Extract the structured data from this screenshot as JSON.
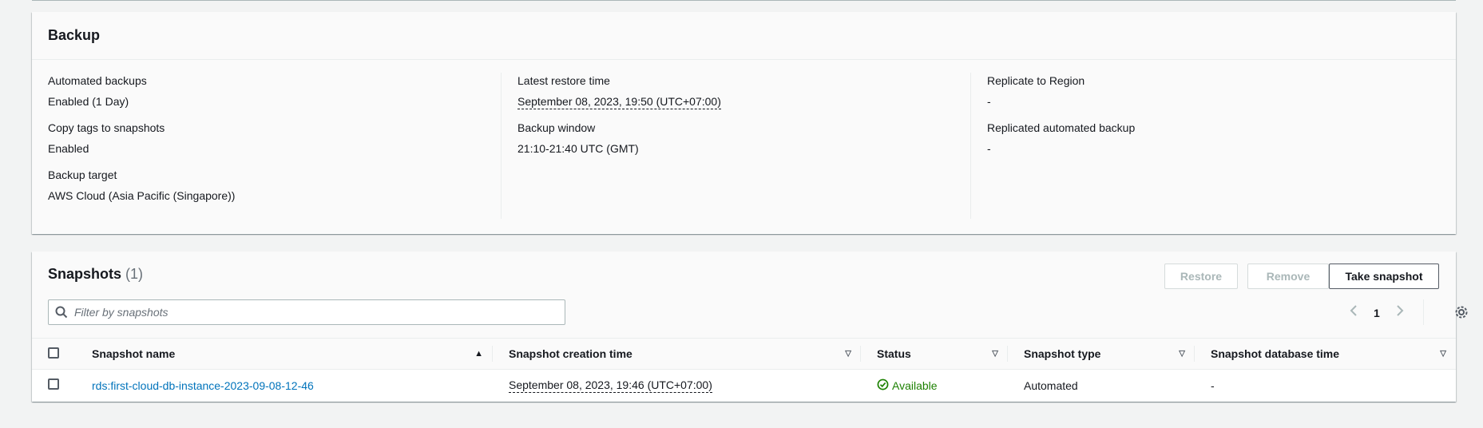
{
  "backup": {
    "title": "Backup",
    "col1": [
      {
        "label": "Automated backups",
        "value": "Enabled (1 Day)"
      },
      {
        "label": "Copy tags to snapshots",
        "value": "Enabled"
      },
      {
        "label": "Backup target",
        "value": "AWS Cloud (Asia Pacific (Singapore))"
      }
    ],
    "col2": [
      {
        "label": "Latest restore time",
        "value": "September 08, 2023, 19:50 (UTC+07:00)"
      },
      {
        "label": "Backup window",
        "value": "21:10-21:40 UTC (GMT)"
      }
    ],
    "col3": [
      {
        "label": "Replicate to Region",
        "value": "-"
      },
      {
        "label": "Replicated automated backup",
        "value": "-"
      }
    ]
  },
  "snapshots": {
    "title": "Snapshots",
    "count": "(1)",
    "buttons": {
      "restore": "Restore",
      "remove": "Remove",
      "take": "Take snapshot"
    },
    "search_placeholder": "Filter by snapshots",
    "page": "1",
    "columns": [
      "Snapshot name",
      "Snapshot creation time",
      "Status",
      "Snapshot type",
      "Snapshot database time"
    ],
    "rows": [
      {
        "name": "rds:first-cloud-db-instance-2023-09-08-12-46",
        "creation_time": "September 08, 2023, 19:46 (UTC+07:00)",
        "status": "Available",
        "type": "Automated",
        "db_time": "-"
      }
    ]
  },
  "colors": {
    "link": "#0073bb",
    "success": "#1d8102",
    "disabled": "#aab7b8"
  },
  "icons": [
    "search-icon",
    "chevron-left-icon",
    "chevron-right-icon",
    "gear-icon",
    "sort-ascending-icon",
    "sort-icon",
    "check-circle-icon"
  ]
}
